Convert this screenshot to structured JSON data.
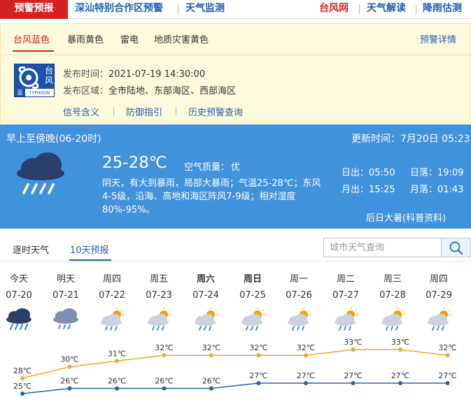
{
  "topnav": {
    "tab1": "预警预报",
    "tab2": "深汕特别合作区预警",
    "tab3": "天气监测",
    "tab4": "台风网",
    "tab5": "天气解读",
    "tab6": "降雨估测"
  },
  "warning": {
    "tabs": [
      "台风蓝色",
      "暴雨黄色",
      "雷电",
      "地质灾害黄色"
    ],
    "detail_link": "预警详情",
    "icon_label": "台风",
    "icon_level": "蓝",
    "icon_en": "TYPHOON",
    "issue_time_label": "发布时间：",
    "issue_time": "2021-07-19 14:30:00",
    "area_label": "发布区域：",
    "area": "全市陆地、东部海区、西部海区",
    "links": [
      "信号含义",
      "防御指引",
      "历史预警查询"
    ]
  },
  "today": {
    "period": "早上至傍晚(06-20时)",
    "update_time": "更新时间：7月20日 05:23",
    "temp": "25-28℃",
    "aqi_label": "空气质量：",
    "aqi": "优",
    "desc_line1": "阴天，有大到暴雨，局部大暴雨；气温25-28℃；东风",
    "desc_line2": "4-5级，沿海、高地和海区阵风7-9级；相对湿度",
    "desc_line3": "80%-95%。",
    "sunrise": "日出：05:50",
    "sunset": "日落：19:09",
    "moonrise": "月出：15:25",
    "moonset": "月落：01:43",
    "solar_term": "后日大暑(科普资料)"
  },
  "tabs": [
    "逐时天气",
    "10天预报"
  ],
  "search": {
    "placeholder": "城市天气查询"
  },
  "days": [
    {
      "week": "今天",
      "date": "07-20",
      "icon": "heavy-rain-icon"
    },
    {
      "week": "明天",
      "date": "07-21",
      "icon": "rain-icon"
    },
    {
      "week": "周四",
      "date": "07-22",
      "icon": "sun-cloud-rain-icon"
    },
    {
      "week": "周五",
      "date": "07-23",
      "icon": "sun-cloud-rain-icon"
    },
    {
      "week": "周六",
      "date": "07-24",
      "icon": "sun-cloud-rain-icon"
    },
    {
      "week": "周日",
      "date": "07-25",
      "icon": "sun-cloud-rain-icon"
    },
    {
      "week": "周一",
      "date": "07-26",
      "icon": "sun-cloud-rain-icon"
    },
    {
      "week": "周二",
      "date": "07-27",
      "icon": "sun-cloud-rain-icon"
    },
    {
      "week": "周三",
      "date": "07-28",
      "icon": "sun-cloud-rain-icon"
    },
    {
      "week": "周四",
      "date": "07-29",
      "icon": "sun-cloud-rain-icon"
    }
  ],
  "colors": {
    "high": "#f5a623",
    "low": "#1f66b8",
    "accent": "#4192dc",
    "red": "#d42020"
  },
  "chart_data": {
    "type": "line",
    "categories": [
      "07-20",
      "07-21",
      "07-22",
      "07-23",
      "07-24",
      "07-25",
      "07-26",
      "07-27",
      "07-28",
      "07-29"
    ],
    "series": [
      {
        "values": [
          28,
          30,
          31,
          32,
          32,
          32,
          32,
          33,
          33,
          32
        ],
        "labels": [
          "28℃",
          "30℃",
          "31℃",
          "32℃",
          "32℃",
          "32℃",
          "32℃",
          "33℃",
          "33℃",
          "32℃"
        ]
      },
      {
        "values": [
          25,
          26,
          26,
          26,
          26,
          27,
          27,
          27,
          27,
          27
        ],
        "labels": [
          "25℃",
          "26℃",
          "26℃",
          "26℃",
          "26℃",
          "27℃",
          "27℃",
          "27℃",
          "27℃",
          "27℃"
        ]
      }
    ]
  }
}
